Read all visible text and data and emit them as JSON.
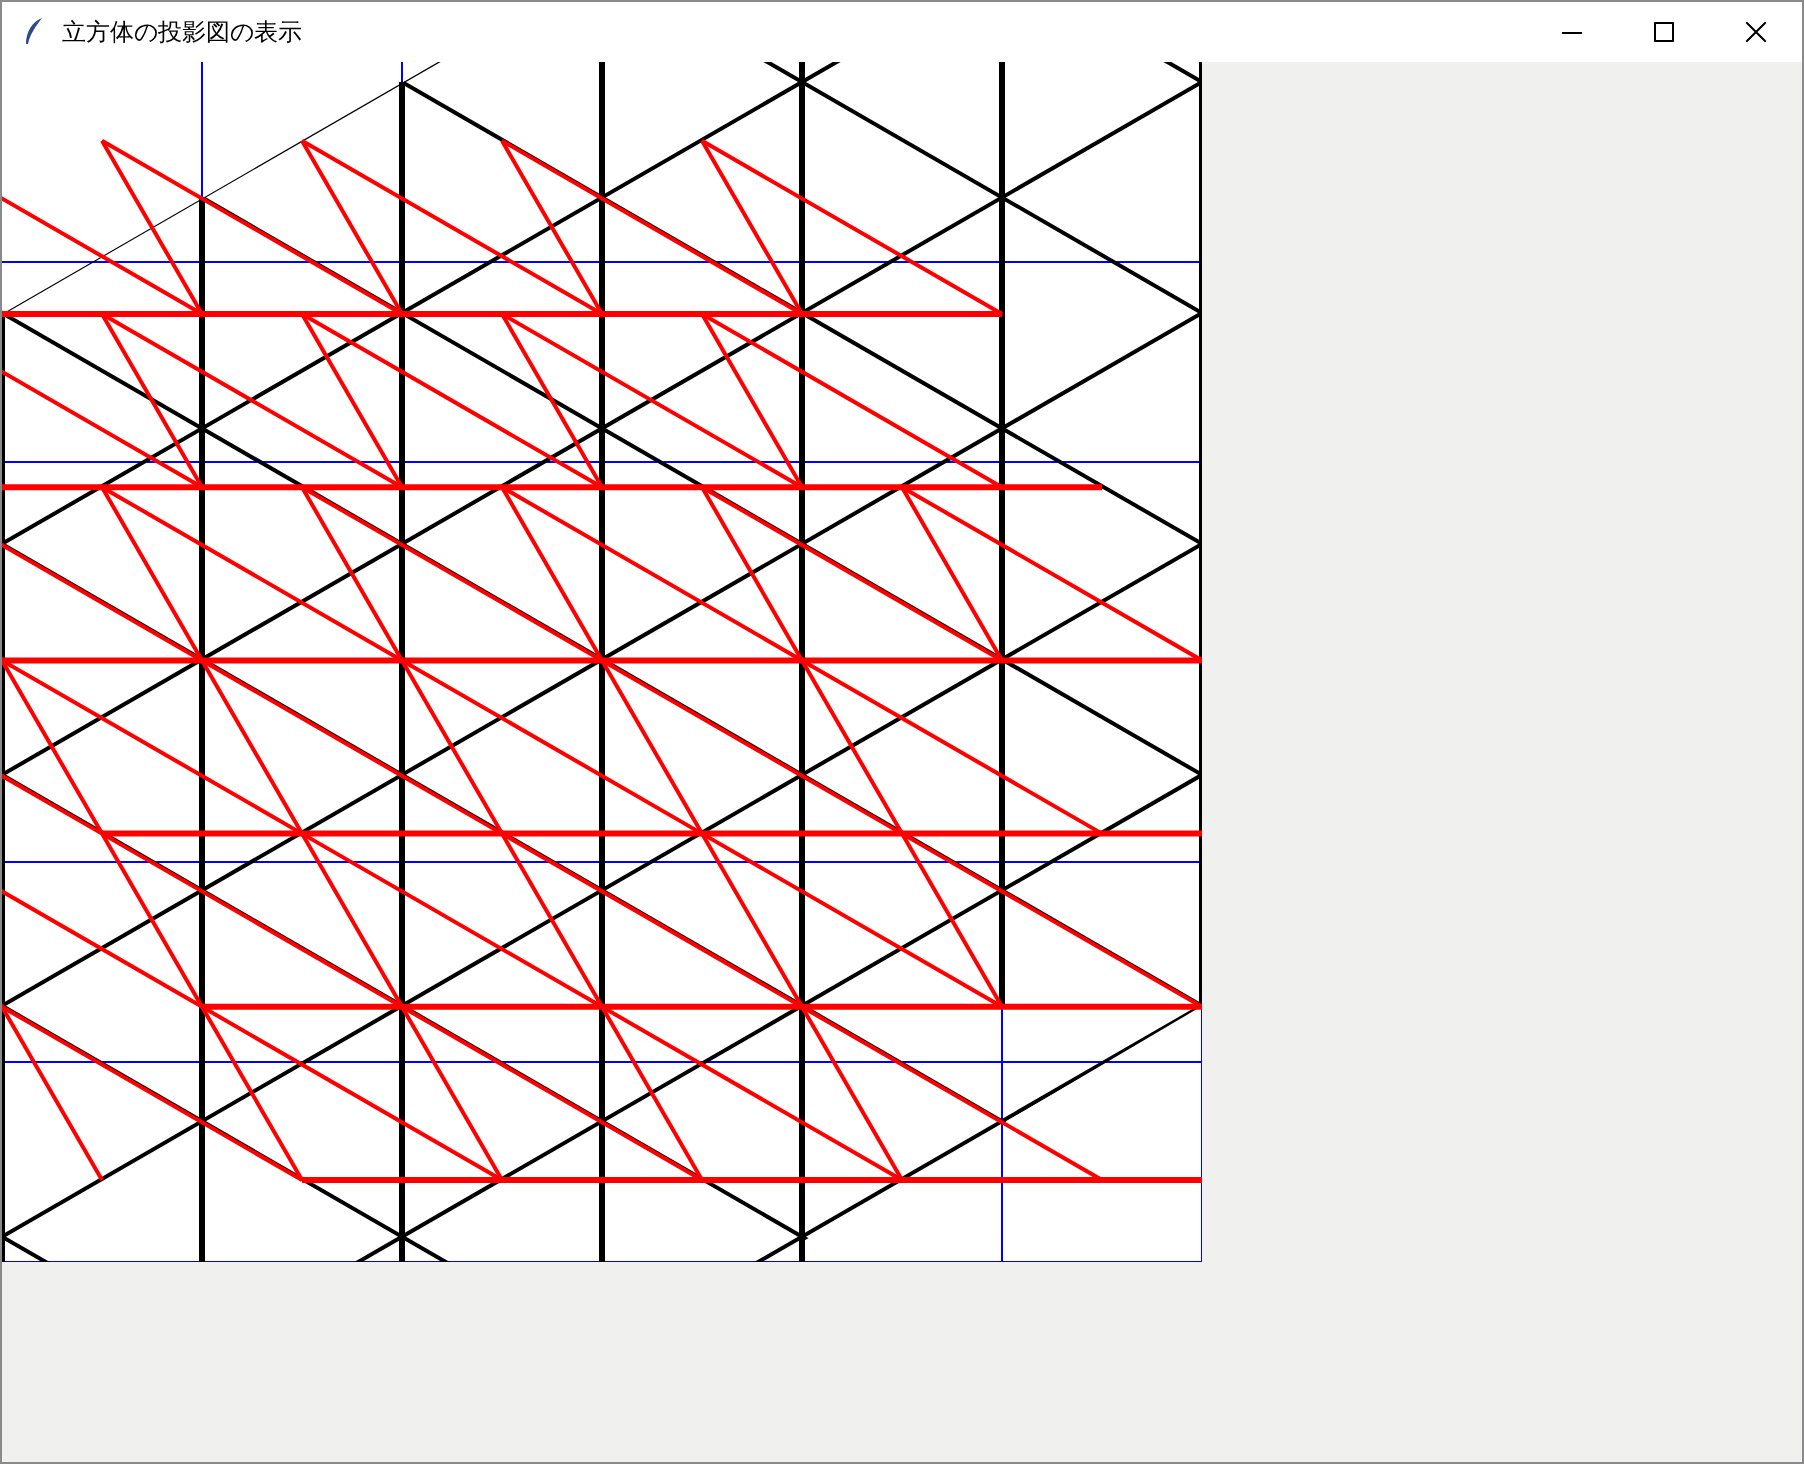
{
  "window": {
    "title": "立方体の投影図の表示"
  }
}
